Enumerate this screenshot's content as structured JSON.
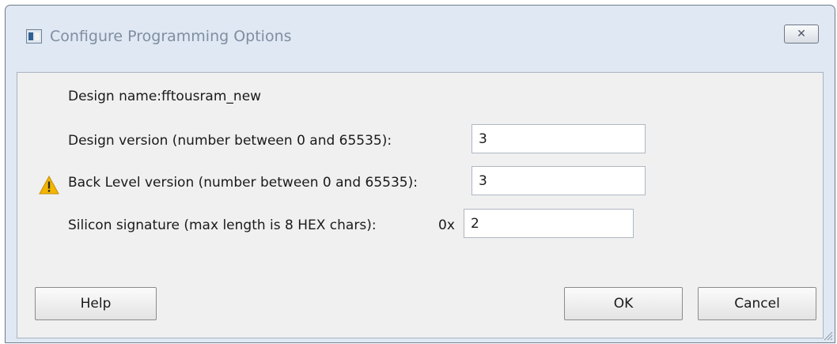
{
  "window": {
    "title": "Configure Programming Options",
    "close_glyph": "✕"
  },
  "form": {
    "design_name_label": "Design name:fftousram_new",
    "design_version_label": "Design version (number between 0 and 65535):",
    "design_version_value": "3",
    "back_level_label": "Back Level version (number between 0 and 65535):",
    "back_level_value": "3",
    "silicon_signature_label": "Silicon signature (max length is 8 HEX chars):",
    "silicon_signature_prefix": "0x",
    "silicon_signature_value": "2"
  },
  "buttons": {
    "help": "Help",
    "ok": "OK",
    "cancel": "Cancel"
  },
  "icons": {
    "app": "app-window-icon",
    "warning": "warning-icon",
    "close": "close-icon",
    "resize": "resize-grip-icon"
  },
  "colors": {
    "frame": "#dfe8f3",
    "client": "#f0f0f0",
    "title_text": "#7f8ea1",
    "warning": "#f2b600"
  }
}
